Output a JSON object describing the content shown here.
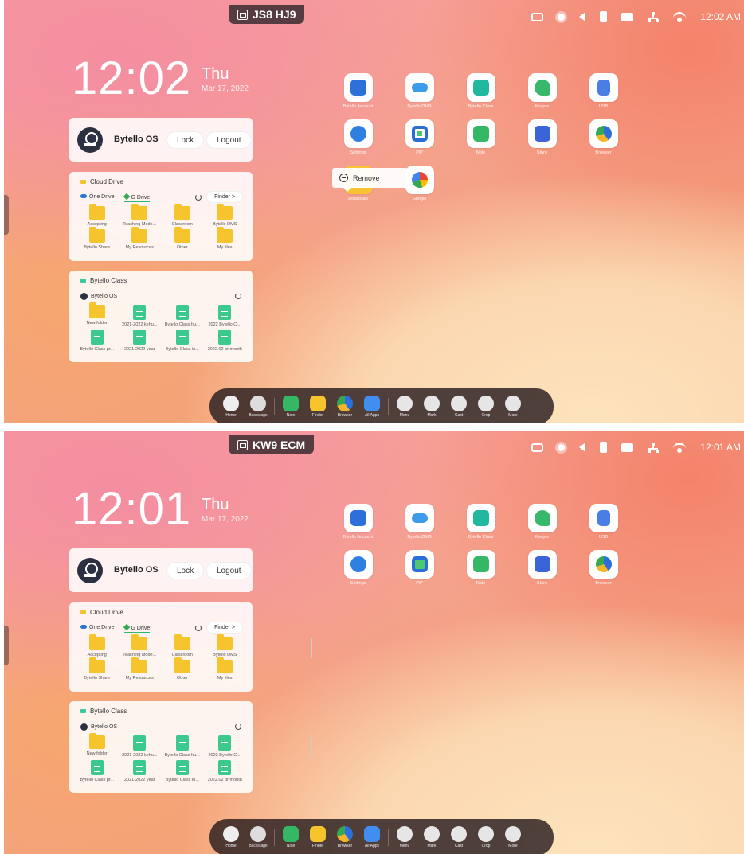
{
  "screens": [
    {
      "badge": "JS8 HJ9",
      "status_time": "12:02 AM",
      "clock": "12:02",
      "day": "Thu",
      "date": "Mar 17, 2022",
      "user": {
        "name": "Bytello OS",
        "lock": "Lock",
        "logout": "Logout"
      },
      "cloud": {
        "title": "Cloud Drive",
        "tab1": "One Drive",
        "tab2": "G Drive",
        "finder": "Finder >",
        "items": [
          "Accepting",
          "Teaching Mode...",
          "Classroom",
          "Bytello DMS",
          "Bytello Share",
          "My Resources",
          "Other",
          "My files"
        ]
      },
      "class": {
        "title": "Bytello Class",
        "user": "Bytello OS",
        "items": [
          "New folder",
          "2021-2022 kehu...",
          "Bytello Class hu...",
          "2022 Bytello Cl...",
          "Bytello Class pr...",
          "2021-2022 year",
          "Bytello Class in...",
          "2022.02 pr month"
        ]
      },
      "apps": [
        "Bytello Account",
        "Bytello DMS",
        "Bytello Class",
        "Keeper",
        "USB",
        "Settings",
        "PiP",
        "Note",
        "Store",
        "Browser",
        "Download",
        "Google"
      ],
      "menu": {
        "remove": "Remove"
      },
      "dock": [
        "Home",
        "Backstage",
        "Note",
        "Finder",
        "Browser",
        "All Apps",
        "Menu",
        "Mark",
        "Cast",
        "Crop",
        "More"
      ]
    },
    {
      "badge": "KW9 ECM",
      "status_time": "12:01 AM",
      "clock": "12:01",
      "day": "Thu",
      "date": "Mar 17, 2022",
      "user": {
        "name": "Bytello OS",
        "lock": "Lock",
        "logout": "Logout"
      },
      "cloud": {
        "title": "Cloud Drive",
        "tab1": "One Drive",
        "tab2": "G Drive",
        "finder": "Finder >",
        "items": [
          "Accepting",
          "Teaching Mode...",
          "Classroom",
          "Bytello DMS",
          "Bytello Share",
          "My Resources",
          "Other",
          "My files"
        ]
      },
      "class": {
        "title": "Bytello Class",
        "user": "Bytello OS",
        "items": [
          "New folder",
          "2021-2022 kehu...",
          "Bytello Class hu...",
          "2022 Bytello Cl...",
          "Bytello Class pr...",
          "2021-2022 year",
          "Bytello Class in...",
          "2022.02 pr month"
        ]
      },
      "apps": [
        "Bytello Account",
        "Bytello DMS",
        "Bytello Class",
        "Keeper",
        "USB",
        "Settings",
        "PiP",
        "Note",
        "Store",
        "Browser"
      ],
      "dock": [
        "Home",
        "Backstage",
        "Note",
        "Finder",
        "Browser",
        "All Apps",
        "Menu",
        "Mark",
        "Cast",
        "Crop",
        "More"
      ]
    }
  ],
  "colors": {
    "accent": "#2bb673",
    "folder": "#f6c42d",
    "doc": "#3cc98e",
    "dock": "#281c1e"
  }
}
